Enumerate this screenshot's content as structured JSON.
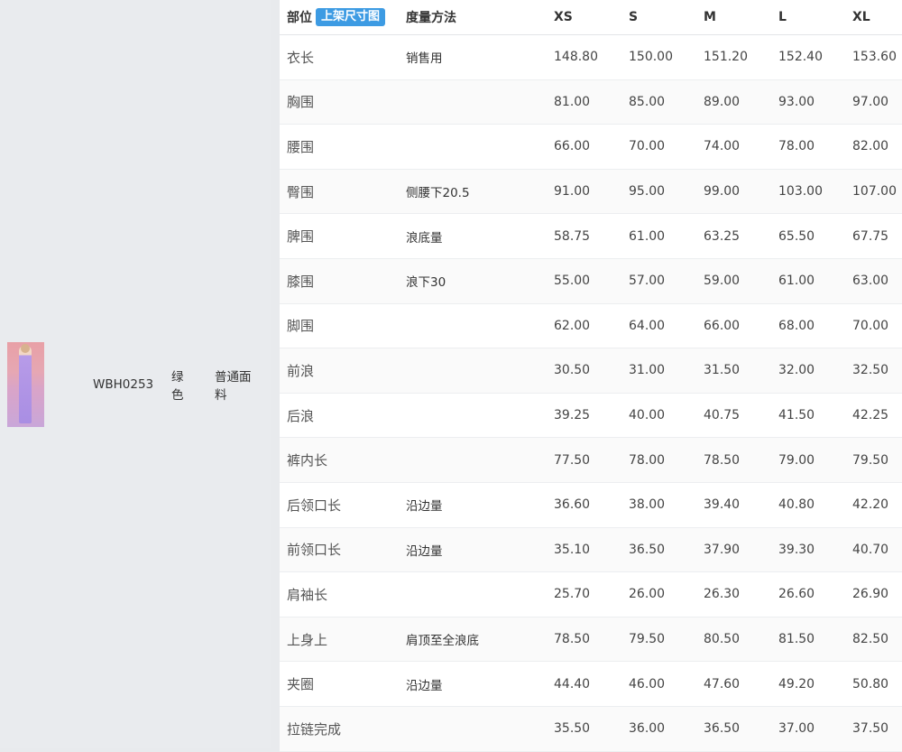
{
  "product": {
    "sku": "WBH0253",
    "color": "绿色",
    "fabric": "普通面料"
  },
  "table": {
    "headers": {
      "part": "部位",
      "badge": "上架尺寸图",
      "method": "度量方法",
      "xs": "XS",
      "s": "S",
      "m": "M",
      "l": "L",
      "xl": "XL"
    },
    "rows": [
      {
        "part": "衣长",
        "method": "销售用",
        "xs": "148.80",
        "s": "150.00",
        "m": "151.20",
        "l": "152.40",
        "xl": "153.60"
      },
      {
        "part": "胸围",
        "method": "",
        "xs": "81.00",
        "s": "85.00",
        "m": "89.00",
        "l": "93.00",
        "xl": "97.00"
      },
      {
        "part": "腰围",
        "method": "",
        "xs": "66.00",
        "s": "70.00",
        "m": "74.00",
        "l": "78.00",
        "xl": "82.00"
      },
      {
        "part": "臀围",
        "method": "侧腰下20.5",
        "xs": "91.00",
        "s": "95.00",
        "m": "99.00",
        "l": "103.00",
        "xl": "107.00"
      },
      {
        "part": "脾围",
        "method": "浪底量",
        "xs": "58.75",
        "s": "61.00",
        "m": "63.25",
        "l": "65.50",
        "xl": "67.75"
      },
      {
        "part": "膝围",
        "method": "浪下30",
        "xs": "55.00",
        "s": "57.00",
        "m": "59.00",
        "l": "61.00",
        "xl": "63.00"
      },
      {
        "part": "脚围",
        "method": "",
        "xs": "62.00",
        "s": "64.00",
        "m": "66.00",
        "l": "68.00",
        "xl": "70.00"
      },
      {
        "part": "前浪",
        "method": "",
        "xs": "30.50",
        "s": "31.00",
        "m": "31.50",
        "l": "32.00",
        "xl": "32.50"
      },
      {
        "part": "后浪",
        "method": "",
        "xs": "39.25",
        "s": "40.00",
        "m": "40.75",
        "l": "41.50",
        "xl": "42.25"
      },
      {
        "part": "裤内长",
        "method": "",
        "xs": "77.50",
        "s": "78.00",
        "m": "78.50",
        "l": "79.00",
        "xl": "79.50"
      },
      {
        "part": "后领口长",
        "method": "沿边量",
        "xs": "36.60",
        "s": "38.00",
        "m": "39.40",
        "l": "40.80",
        "xl": "42.20"
      },
      {
        "part": "前领口长",
        "method": "沿边量",
        "xs": "35.10",
        "s": "36.50",
        "m": "37.90",
        "l": "39.30",
        "xl": "40.70"
      },
      {
        "part": "肩袖长",
        "method": "",
        "xs": "25.70",
        "s": "26.00",
        "m": "26.30",
        "l": "26.60",
        "xl": "26.90"
      },
      {
        "part": "上身上",
        "method": "肩顶至全浪底",
        "xs": "78.50",
        "s": "79.50",
        "m": "80.50",
        "l": "81.50",
        "xl": "82.50"
      },
      {
        "part": "夹圈",
        "method": "沿边量",
        "xs": "44.40",
        "s": "46.00",
        "m": "47.60",
        "l": "49.20",
        "xl": "50.80"
      },
      {
        "part": "拉链完成",
        "method": "",
        "xs": "35.50",
        "s": "36.00",
        "m": "36.50",
        "l": "37.00",
        "xl": "37.50"
      }
    ]
  }
}
